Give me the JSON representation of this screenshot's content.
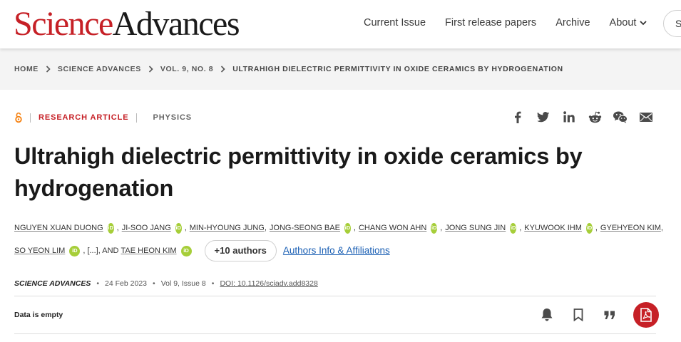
{
  "header": {
    "logo_science": "Science",
    "logo_advances": "Advances",
    "nav": [
      "Current Issue",
      "First release papers",
      "Archive"
    ],
    "about_label": "About",
    "search_label": "S"
  },
  "breadcrumb": [
    "HOME",
    "SCIENCE ADVANCES",
    "VOL. 9, NO. 8",
    "ULTRAHIGH DIELECTRIC PERMITTIVITY IN OXIDE CERAMICS BY HYDROGENATION"
  ],
  "article": {
    "type": "RESEARCH ARTICLE",
    "subject": "PHYSICS",
    "title": "Ultrahigh dielectric permittivity in oxide ceramics by hydrogenation",
    "authors_line1": [
      {
        "name": "NGUYEN XUAN DUONG",
        "orcid": true
      },
      {
        "name": "JI-SOO JANG",
        "orcid": true
      },
      {
        "name": "MIN-HYOUNG JUNG",
        "orcid": false
      },
      {
        "name": "JONG-SEONG BAE",
        "orcid": true
      },
      {
        "name": "CHANG WON AHN",
        "orcid": true
      },
      {
        "name": "JONG SUNG JIN",
        "orcid": true
      },
      {
        "name": "KYUWOOK IHM",
        "orcid": true
      },
      {
        "name": "GYEHYEON KIM",
        "orcid": false
      }
    ],
    "author_so_yeon": "SO YEON LIM",
    "ellipsis": ", [...], AND",
    "author_last": "TAE HEON KIM",
    "more_authors": "+10 authors",
    "affiliations_link": "Authors Info & Affiliations",
    "orcid_label": "iD",
    "journal": "SCIENCE ADVANCES",
    "date": "24 Feb 2023",
    "volume_issue": "Vol 9, Issue 8",
    "doi": "DOI: 10.1126/sciadv.add8328",
    "data_status": "Data is empty"
  },
  "colors": {
    "brand": "#c62026",
    "orcid": "#a6ce39",
    "link": "#1a5fb4"
  },
  "icons": {
    "share": [
      "facebook-icon",
      "twitter-icon",
      "linkedin-icon",
      "reddit-icon",
      "wechat-icon",
      "email-icon"
    ],
    "tools": [
      "bell-icon",
      "bookmark-icon",
      "quote-icon",
      "pdf-icon"
    ]
  }
}
